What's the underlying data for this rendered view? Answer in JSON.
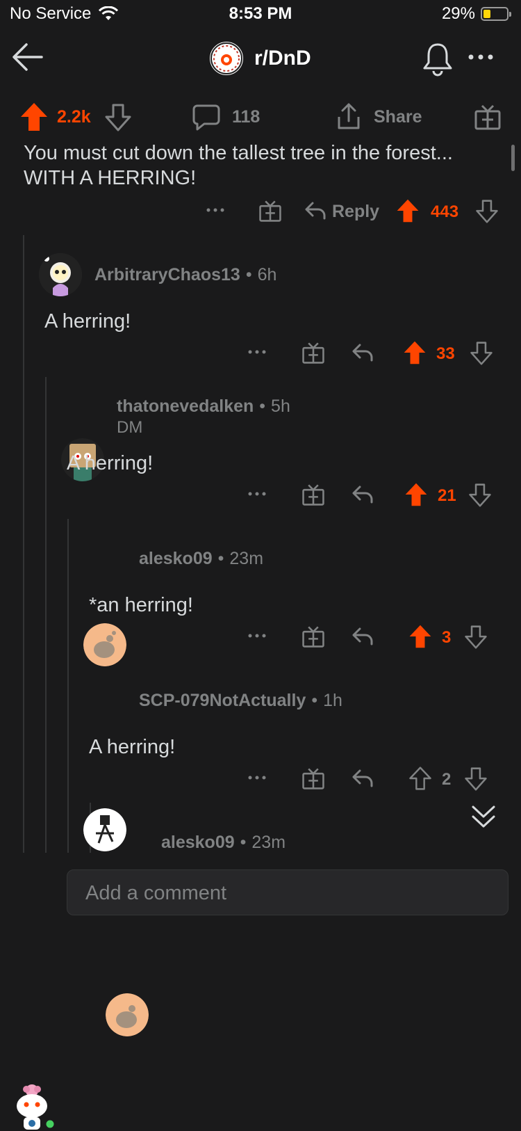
{
  "status": {
    "carrier": "No Service",
    "time": "8:53 PM",
    "battery": "29%"
  },
  "nav": {
    "subreddit": "r/DnD"
  },
  "post_bar": {
    "score": "2.2k",
    "comments": "118",
    "share_label": "Share"
  },
  "comment_root": {
    "text": "You must cut down the tallest tree in the forest... WITH A HERRING!",
    "reply_label": "Reply",
    "score": "443"
  },
  "comments": [
    {
      "user": "ArbitraryChaos13",
      "age": "6h",
      "flair": "",
      "body": "A herring!",
      "score": "33",
      "upvoted": true
    },
    {
      "user": "thatonevedalken",
      "age": "5h",
      "flair": "DM",
      "body": "A herring!",
      "score": "21",
      "upvoted": true
    },
    {
      "user": "alesko09",
      "age": "23m",
      "flair": "",
      "body": "*an herring!",
      "score": "3",
      "upvoted": true
    },
    {
      "user": "SCP-079NotActually",
      "age": "1h",
      "flair": "",
      "body": "A herring!",
      "score": "2",
      "upvoted": false
    },
    {
      "user": "alesko09",
      "age": "23m",
      "flair": "",
      "body": "",
      "score": "",
      "upvoted": false
    }
  ],
  "composer": {
    "placeholder": "Add a comment"
  },
  "colors": {
    "background": "#1a1a1b",
    "upvote": "#ff4500",
    "muted": "#818384",
    "text": "#d7dadc"
  }
}
